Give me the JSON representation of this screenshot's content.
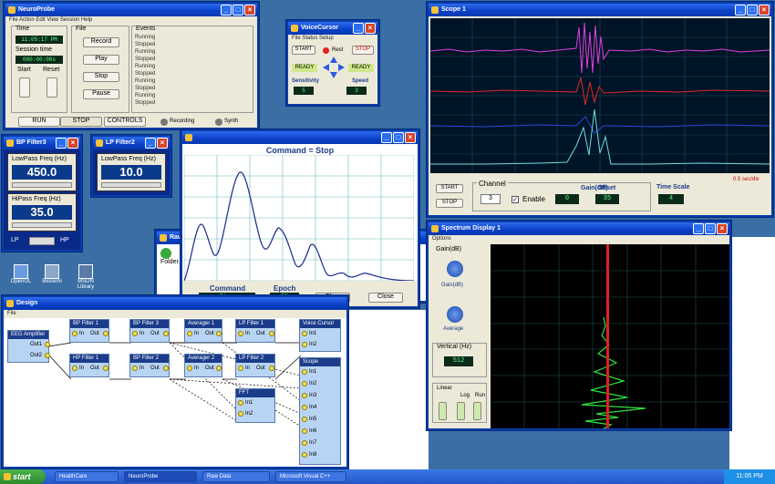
{
  "neuroprobe": {
    "title": "NeuroProbe",
    "menu": "File  Action  Edit  View  Session  Help",
    "time_label": "Time",
    "time_value": "11:05:17 PM",
    "session_label": "Session time",
    "session_value": "000:00:00s",
    "start_label": "Start",
    "reset_label": "Reset",
    "file_label": "File",
    "events_label": "Events",
    "record": "Record",
    "play": "Play",
    "stop": "Stop",
    "pause": "Pause",
    "events": [
      "Running",
      "Stopped",
      "Running",
      "Stopped",
      "Running",
      "Stopped",
      "Running",
      "Stopped",
      "Running",
      "Stopped"
    ],
    "run": "RUN",
    "stop_btn": "STOP",
    "controls": "CONTROLS",
    "led1": "Recording",
    "led2": "Synth"
  },
  "voicecursor": {
    "title": "VoiceCursor",
    "menu": "File  Status  Setup",
    "start": "START",
    "rest": "Rest",
    "stop": "STOP",
    "ready1": "READY",
    "ready2": "READY",
    "sens_label": "Sensitivity",
    "sens_value": "5",
    "speed_label": "Speed",
    "speed_value": "3"
  },
  "bpfilter": {
    "title": "BP Filter3",
    "low_label": "LowPass Freq (Hz)",
    "low_value": "450.0",
    "high_label": "HiPass Freq (Hz)",
    "high_value": "35.0",
    "lp": "LP",
    "hp": "HP"
  },
  "lpfilter": {
    "title": "LP Filter2",
    "label": "LowPass Freq (Hz)",
    "value": "10.0"
  },
  "command": {
    "title": "Command = Stop",
    "cmd_label": "Command",
    "cmd_value": "Stop",
    "epoch_label": "Epoch",
    "epoch_value": "25",
    "clear": "Clear",
    "close": "Close"
  },
  "scope": {
    "title": "Scope 1",
    "start": "START",
    "stop": "STOP",
    "channel_label": "Channel",
    "channel_value": "3",
    "enable_label": "Enable",
    "gain_label": "Gain(dB)",
    "gain_value": "0",
    "offset_label": "Offset",
    "offset_value": "35",
    "timescale_label": "Time Scale",
    "timescale_value": "4",
    "range": "0.5 sec/div"
  },
  "spectrum": {
    "title": "Spectrum Display 1",
    "menu": "Options",
    "gain_label": "Gain(dB)",
    "gain_knob": "Gain(dB)",
    "average_knob": "Average",
    "vscale_label": "Vertical (Hz)",
    "vscale_value": "512",
    "linear": "Linear",
    "log": "Log",
    "run": "Run"
  },
  "design": {
    "title": "Design",
    "menu": "File",
    "nodes": [
      {
        "title": "EEG Amplifier",
        "ports": [
          "Out1",
          "Out2"
        ]
      },
      {
        "title": "BP Filter 1",
        "ports": [
          "In",
          "Out"
        ]
      },
      {
        "title": "BP Filter 3",
        "ports": [
          "In",
          "Out"
        ]
      },
      {
        "title": "Averager 1",
        "ports": [
          "In",
          "Out"
        ]
      },
      {
        "title": "LP Filter 1",
        "ports": [
          "In",
          "Out"
        ]
      },
      {
        "title": "Voice Cursor",
        "ports": [
          "In1",
          "In2"
        ]
      },
      {
        "title": "HP Filter 1",
        "ports": [
          "In",
          "Out"
        ]
      },
      {
        "title": "BP Filter 2",
        "ports": [
          "In",
          "Out"
        ]
      },
      {
        "title": "Averager 2",
        "ports": [
          "In",
          "Out"
        ]
      },
      {
        "title": "LP Filter 2",
        "ports": [
          "In",
          "Out"
        ]
      },
      {
        "title": "Scope",
        "ports": [
          "In1",
          "In2",
          "In3",
          "In4",
          "In5",
          "In6",
          "In7",
          "In8"
        ]
      },
      {
        "title": "FFT",
        "ports": [
          "In1",
          "In2"
        ]
      }
    ]
  },
  "rawdata": {
    "title": "Raw Data",
    "label": "Folder"
  },
  "desktop": {
    "icons": [
      "OpenGL",
      "Biosemi",
      "MSDN Library"
    ]
  },
  "taskbar": {
    "start": "start",
    "items": [
      "HealthCare",
      "NeuroProbe",
      "Raw Data",
      "Microsoft Visual C++"
    ],
    "clock": "11:05 PM"
  },
  "colors": {
    "titlebar": "#0a3fc6",
    "lcd_bg": "#0b2a1a",
    "lcd_fg": "#5cff7c",
    "scope_bg": "#001428"
  }
}
